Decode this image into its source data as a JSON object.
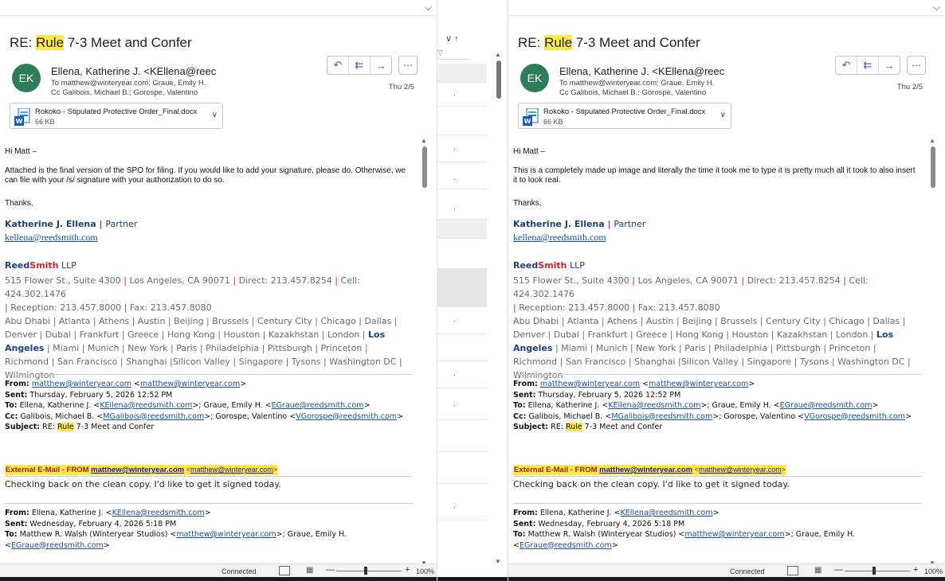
{
  "left": {
    "subject_prefix": "RE: ",
    "subject_highlight": "Rule",
    "subject_rest": " 7-3 Meet and Confer",
    "avatar_initials": "EK",
    "sender": "Ellena, Katherine J. <KEllena@reec",
    "to": "To  matthew@winteryear.com; Graue, Emily H.",
    "cc": "Cc  Galibois, Michael B.; Gorospe, Valentino",
    "date": "Thu 2/5",
    "attachment_name": "Rokoko - Stipulated Protective Order_Final.docx",
    "attachment_size": "66 KB",
    "greeting": "Hi Matt –",
    "paragraph": "Attached is the final version of the SPO for filing.  If you would like to add your signature, please do.  Otherwise, we can file with your /s/ signature with your authorization to do so.",
    "thanks": "Thanks,",
    "sig_name": "Katherine J. Ellena",
    "sig_role": "Partner",
    "sig_email": "kellena@reedsmith.com",
    "firm_reed": "Reed",
    "firm_smith": "Smith",
    "firm_llp": " LLP"
  },
  "right": {
    "subject_prefix": "RE: ",
    "subject_highlight": "Rule",
    "subject_rest": " 7-3 Meet and Confer",
    "avatar_initials": "EK",
    "sender": "Ellena, Katherine J. <KEllena@reec",
    "to": "To  matthew@winteryear.com; Graue, Emily H.",
    "cc": "Cc  Galibois, Michael B.; Gorospe, Valentino",
    "date": "Thu 2/5",
    "attachment_name": "Rokoko - Stipulated Protective Order_Final.docx",
    "attachment_size": "66 KB",
    "greeting": "Hi Matt –",
    "paragraph": "This is a completely made up image and literally the time it took me to type it is pretty much all it took to also insert it to look real.",
    "thanks": "Thanks,",
    "sig_name": "Katherine J. Ellena",
    "sig_role": "Partner",
    "sig_email": "kellena@reedsmith.com",
    "firm_reed": "Reed",
    "firm_smith": "Smith",
    "firm_llp": " LLP"
  },
  "address": {
    "line1a": "515 Flower St., Suite 4300",
    "line1b": "Los Angeles, CA 90071",
    "line1c": "Direct: 213.457.8254",
    "line1d": "Cell: 424.302.1476",
    "line2a": "Reception: 213.457.8000",
    "line2b": "Fax: 213.457.8080",
    "offices_1": "Abu Dhabi | Atlanta | Athens | Austin | Beijing | Brussels | Century City | Chicago | Dallas |",
    "offices_2": "Denver | Dubai  | Frankfurt | Greece | Hong Kong | Houston | Kazakhstan | London |",
    "offices_los": "Los",
    "offices_angeles": "Angeles",
    "offices_3": " | Miami | Munich | New York | Paris | Philadelphia | Pittsburgh | Princeton |",
    "offices_4": "Richmond | San Francisco | Shanghai |Silicon Valley | Singapore | Tysons | Washington DC |",
    "offices_5": "Wilmington"
  },
  "thread1": {
    "from_label": "From:",
    "from_link": "matthew@winteryear.com",
    "from_angle": "matthew@winteryear.com",
    "sent_label": "Sent:",
    "sent": "Thursday, February 5, 2026 12:52 PM",
    "to_label": "To:",
    "to_name1": "Ellena, Katherine J.",
    "to_link1": "KEllena@reedsmith.com",
    "to_name2": "; Graue, Emily H.",
    "to_link2": "EGraue@reedsmith.com",
    "cc_label": "Cc:",
    "cc_name1": "Galibois, Michael B.",
    "cc_link1": "MGalibois@reedsmith.com",
    "cc_name2": "; Gorospe, Valentino",
    "cc_link2": "VGorospe@reedsmith.com",
    "subject_label": "Subject:",
    "subject_pre": "RE: ",
    "subject_hl": "Rule",
    "subject_post": " 7-3 Meet and Confer"
  },
  "external": {
    "label": "External E-Mail - FROM ",
    "link": "matthew@winteryear.com",
    "angle": "matthew@winteryear.com",
    "message": "Checking back on the clean copy. I'd like to get it signed today."
  },
  "thread2": {
    "from_label": "From:",
    "from_name": "Ellena, Katherine J.",
    "from_link": "KEllena@reedsmith.com",
    "sent_label": "Sent:",
    "sent": "Wednesday, February 4, 2026 5:18 PM",
    "to_label": "To:",
    "to_name": "Matthew R. Walsh (Winteryear Studios)",
    "to_link": "matthew@winteryear.com",
    "to_name2": "; Graue, Emily H.",
    "to_link2": "EGraue@reedsmith.com"
  },
  "status": {
    "text": "Connected",
    "zoom_minus": "—",
    "zoom_plus": "+",
    "zoom": "100%",
    "zoom_level": 0.45
  },
  "icons": {
    "reply": "reply-icon",
    "reply_all": "reply-all-icon",
    "forward": "forward-icon",
    "more": "more-icon",
    "word": "word-doc-icon"
  },
  "colors": {
    "highlight": "#ffe94a",
    "link": "#1a4ea3",
    "firm_blue": "#1f3f73",
    "firm_red": "#d41f2b",
    "avatar": "#2e7d59"
  }
}
